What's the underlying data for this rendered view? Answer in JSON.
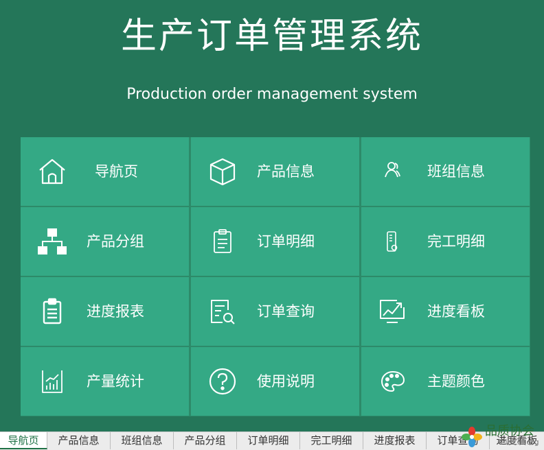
{
  "header": {
    "title": "生产订单管理系统",
    "subtitle": "Production order management system"
  },
  "tiles": [
    {
      "label": "导航页",
      "icon": "home-icon"
    },
    {
      "label": "产品信息",
      "icon": "box-icon"
    },
    {
      "label": "班组信息",
      "icon": "team-icon"
    },
    {
      "label": "产品分组",
      "icon": "hierarchy-icon"
    },
    {
      "label": "订单明细",
      "icon": "clipboard-icon"
    },
    {
      "label": "完工明细",
      "icon": "thermometer-icon"
    },
    {
      "label": "进度报表",
      "icon": "report-clipboard-icon"
    },
    {
      "label": "订单查询",
      "icon": "search-document-icon"
    },
    {
      "label": "进度看板",
      "icon": "trend-chart-icon"
    },
    {
      "label": "产量统计",
      "icon": "bar-chart-icon"
    },
    {
      "label": "使用说明",
      "icon": "question-icon"
    },
    {
      "label": "主题颜色",
      "icon": "palette-icon"
    }
  ],
  "sheet_tabs": [
    {
      "label": "导航页",
      "active": true
    },
    {
      "label": "产品信息"
    },
    {
      "label": "班组信息"
    },
    {
      "label": "产品分组"
    },
    {
      "label": "订单明细"
    },
    {
      "label": "完工明细"
    },
    {
      "label": "进度报表"
    },
    {
      "label": "订单查询"
    },
    {
      "label": "进度看板"
    }
  ],
  "watermark": {
    "cn": "品质协会",
    "en": "iPinZhi.org"
  },
  "colors": {
    "background": "#247659",
    "grid_line": "#2d8a69",
    "tile": "#34a985",
    "text": "#ffffff",
    "active_tab": "#1e7145"
  }
}
